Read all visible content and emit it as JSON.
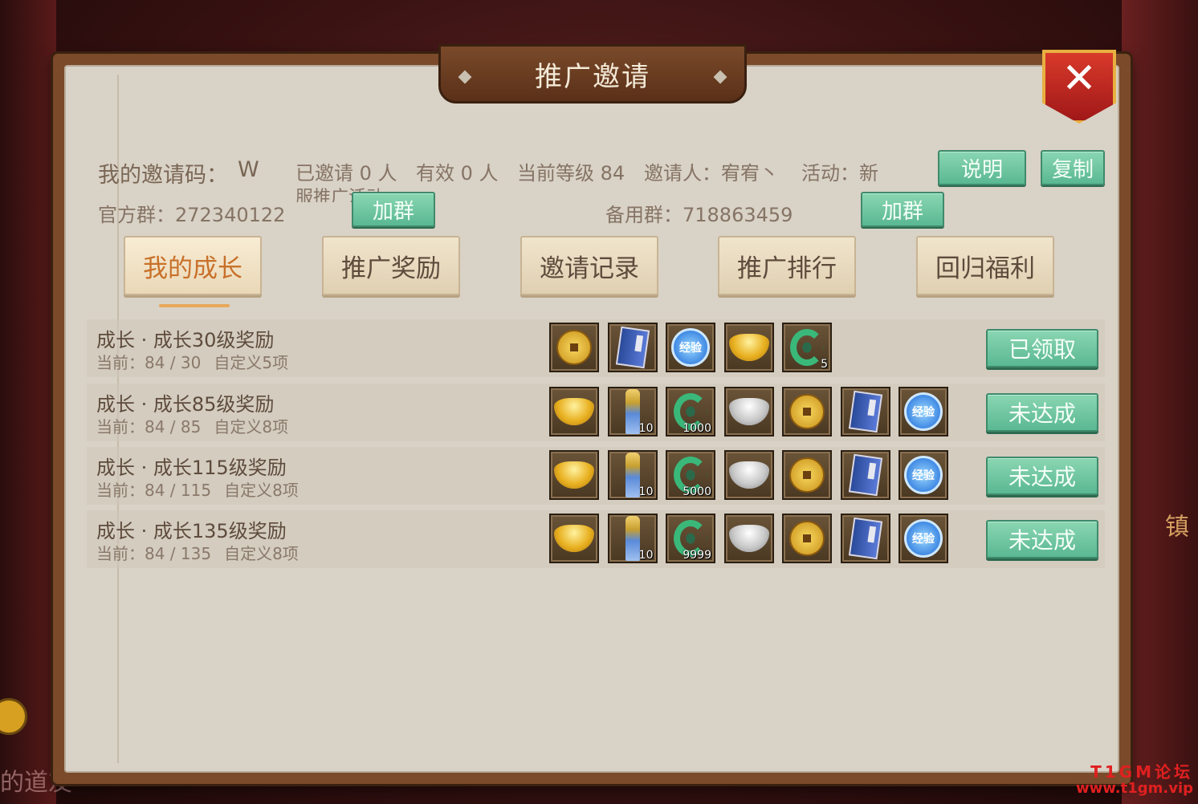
{
  "window": {
    "title": "推广邀请"
  },
  "info": {
    "invite_code_label": "我的邀请码：",
    "invite_code_value": "W",
    "invited": "已邀请 0 人",
    "valid": "有效 0 人",
    "level": "当前等级 84",
    "inviter": "邀请人：宥宥丶",
    "activity": "活动：新",
    "overflow_text": "服推广活动",
    "official_group": "官方群：272340122",
    "backup_group": "备用群：718863459"
  },
  "buttons": {
    "explain": "说明",
    "copy": "复制",
    "join_group": "加群",
    "join_group_backup": "加群"
  },
  "tabs": [
    {
      "label": "我的成长",
      "active": true
    },
    {
      "label": "推广奖励",
      "active": false
    },
    {
      "label": "邀请记录",
      "active": false
    },
    {
      "label": "推广排行",
      "active": false
    },
    {
      "label": "回归福利",
      "active": false
    }
  ],
  "rewards": [
    {
      "title": "成长 · 成长30级奖励",
      "progress": "当前：84 / 30",
      "custom": "自定义5项",
      "status": "已领取",
      "items": [
        {
          "icon": "copper-coin-icon",
          "count": ""
        },
        {
          "icon": "skill-book-icon",
          "count": ""
        },
        {
          "icon": "exp-orb-icon",
          "label": "经验",
          "count": ""
        },
        {
          "icon": "gold-ingot-icon",
          "count": ""
        },
        {
          "icon": "jade-dragon-icon",
          "count": "5"
        }
      ]
    },
    {
      "title": "成长 · 成长85级奖励",
      "progress": "当前：84 / 85",
      "custom": "自定义8项",
      "status": "未达成",
      "items": [
        {
          "icon": "gold-ingot-icon",
          "count": ""
        },
        {
          "icon": "sword-icon",
          "count": "10"
        },
        {
          "icon": "jade-dragon-icon",
          "count": "1000"
        },
        {
          "icon": "silver-ingot-icon",
          "count": ""
        },
        {
          "icon": "copper-coin-icon",
          "count": ""
        },
        {
          "icon": "skill-book-icon",
          "count": ""
        },
        {
          "icon": "exp-orb-icon",
          "label": "经验",
          "count": ""
        }
      ]
    },
    {
      "title": "成长 · 成长115级奖励",
      "progress": "当前：84 / 115",
      "custom": "自定义8项",
      "status": "未达成",
      "items": [
        {
          "icon": "gold-ingot-icon",
          "count": ""
        },
        {
          "icon": "sword-icon",
          "count": "10"
        },
        {
          "icon": "jade-dragon-icon",
          "count": "5000"
        },
        {
          "icon": "silver-ingot-icon",
          "count": ""
        },
        {
          "icon": "copper-coin-icon",
          "count": ""
        },
        {
          "icon": "skill-book-icon",
          "count": ""
        },
        {
          "icon": "exp-orb-icon",
          "label": "经验",
          "count": ""
        }
      ]
    },
    {
      "title": "成长 · 成长135级奖励",
      "progress": "当前：84 / 135",
      "custom": "自定义8项",
      "status": "未达成",
      "items": [
        {
          "icon": "gold-ingot-icon",
          "count": ""
        },
        {
          "icon": "sword-icon",
          "count": "10"
        },
        {
          "icon": "jade-dragon-icon",
          "count": "9999"
        },
        {
          "icon": "silver-ingot-icon",
          "count": ""
        },
        {
          "icon": "copper-coin-icon",
          "count": ""
        },
        {
          "icon": "skill-book-icon",
          "count": ""
        },
        {
          "icon": "exp-orb-icon",
          "label": "经验",
          "count": ""
        }
      ]
    }
  ],
  "background": {
    "left_text": "的道友",
    "right_text": "镇"
  },
  "watermark": {
    "line1": "T1GM论坛",
    "line2": "www.t1gm.vip"
  },
  "colors": {
    "accent_green": "#5ab892",
    "active_tab_text": "#c8702a",
    "close_red": "#c82a20"
  }
}
